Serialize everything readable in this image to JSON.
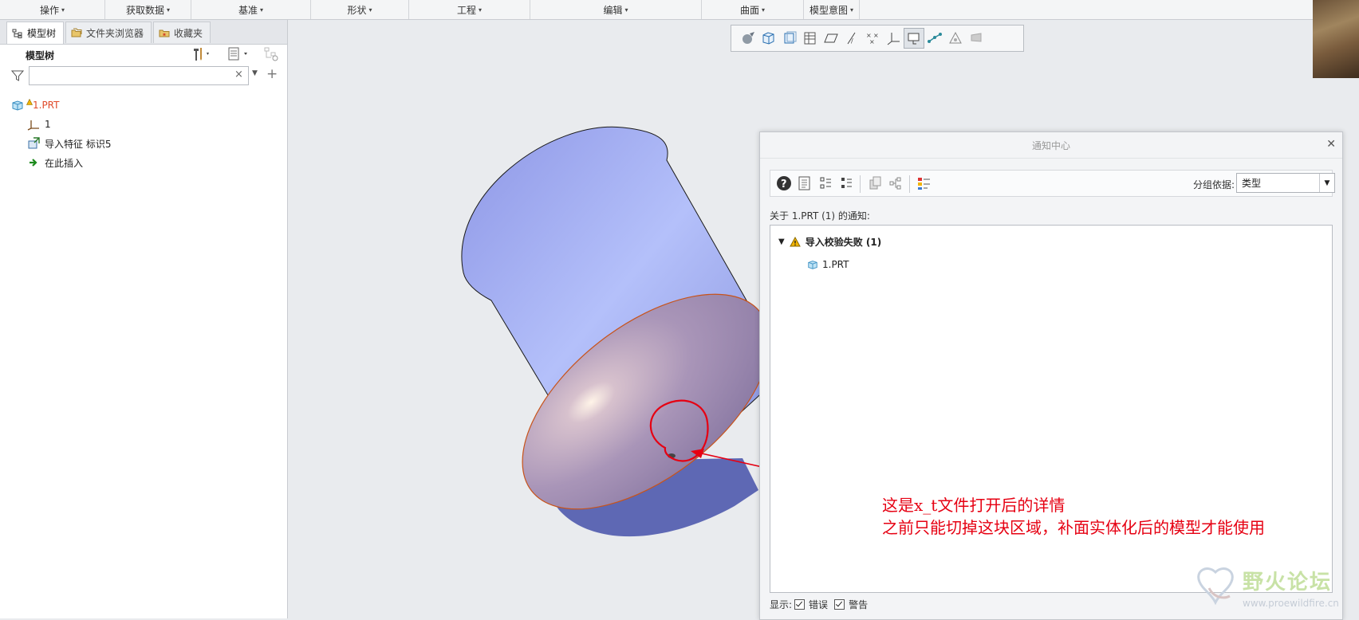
{
  "ribbon": {
    "tabs": [
      "操作",
      "获取数据",
      "基准",
      "形状",
      "工程",
      "编辑",
      "曲面",
      "模型意图"
    ]
  },
  "left_panel": {
    "tabs": [
      {
        "label": "模型树",
        "icon": "tree-icon"
      },
      {
        "label": "文件夹浏览器",
        "icon": "folder-browser-icon"
      },
      {
        "label": "收藏夹",
        "icon": "favorites-icon"
      }
    ],
    "title": "模型树",
    "search": {
      "placeholder": "",
      "value": ""
    },
    "tree": [
      {
        "label": "1.PRT",
        "icon": "part-icon",
        "warning": true,
        "color": "#e04a2a"
      },
      {
        "label": "1",
        "icon": "coordinate-system-icon"
      },
      {
        "label": "导入特征 标识5",
        "icon": "import-feature-icon"
      },
      {
        "label": "在此插入",
        "icon": "insert-here-arrow-icon"
      }
    ]
  },
  "graphics_toolbar": {
    "icons": [
      "appearance-icon",
      "display-style-icon",
      "saved-views-icon",
      "view-manager-icon",
      "plane-display-icon",
      "axis-display-icon",
      "point-display-icon",
      "csys-display-icon",
      "spin-center-icon",
      "annotation-display-icon",
      "render-icon",
      "perspective-icon"
    ]
  },
  "notification_center": {
    "title": "通知中心",
    "group_by_label": "分组依据:",
    "group_by_value": "类型",
    "about": "关于 1.PRT (1) 的通知:",
    "group": {
      "label": "导入校验失败 (1)",
      "item": "1.PRT"
    },
    "footer": {
      "show_label": "显示:",
      "errors_label": "错误",
      "warnings_label": "警告",
      "errors_checked": true,
      "warnings_checked": true
    }
  },
  "annotation": {
    "line1": "这是x_t文件打开后的详情",
    "line2": "之前只能切掉这块区域，补面实体化后的模型才能使用"
  },
  "watermark": {
    "title": "野火论坛",
    "url": "www.proewildfire.cn"
  },
  "colors": {
    "accent": "#1b6ec2",
    "annotation": "#e60012",
    "part_body": "#a8b4f4",
    "part_face": "#b7a0c0"
  }
}
